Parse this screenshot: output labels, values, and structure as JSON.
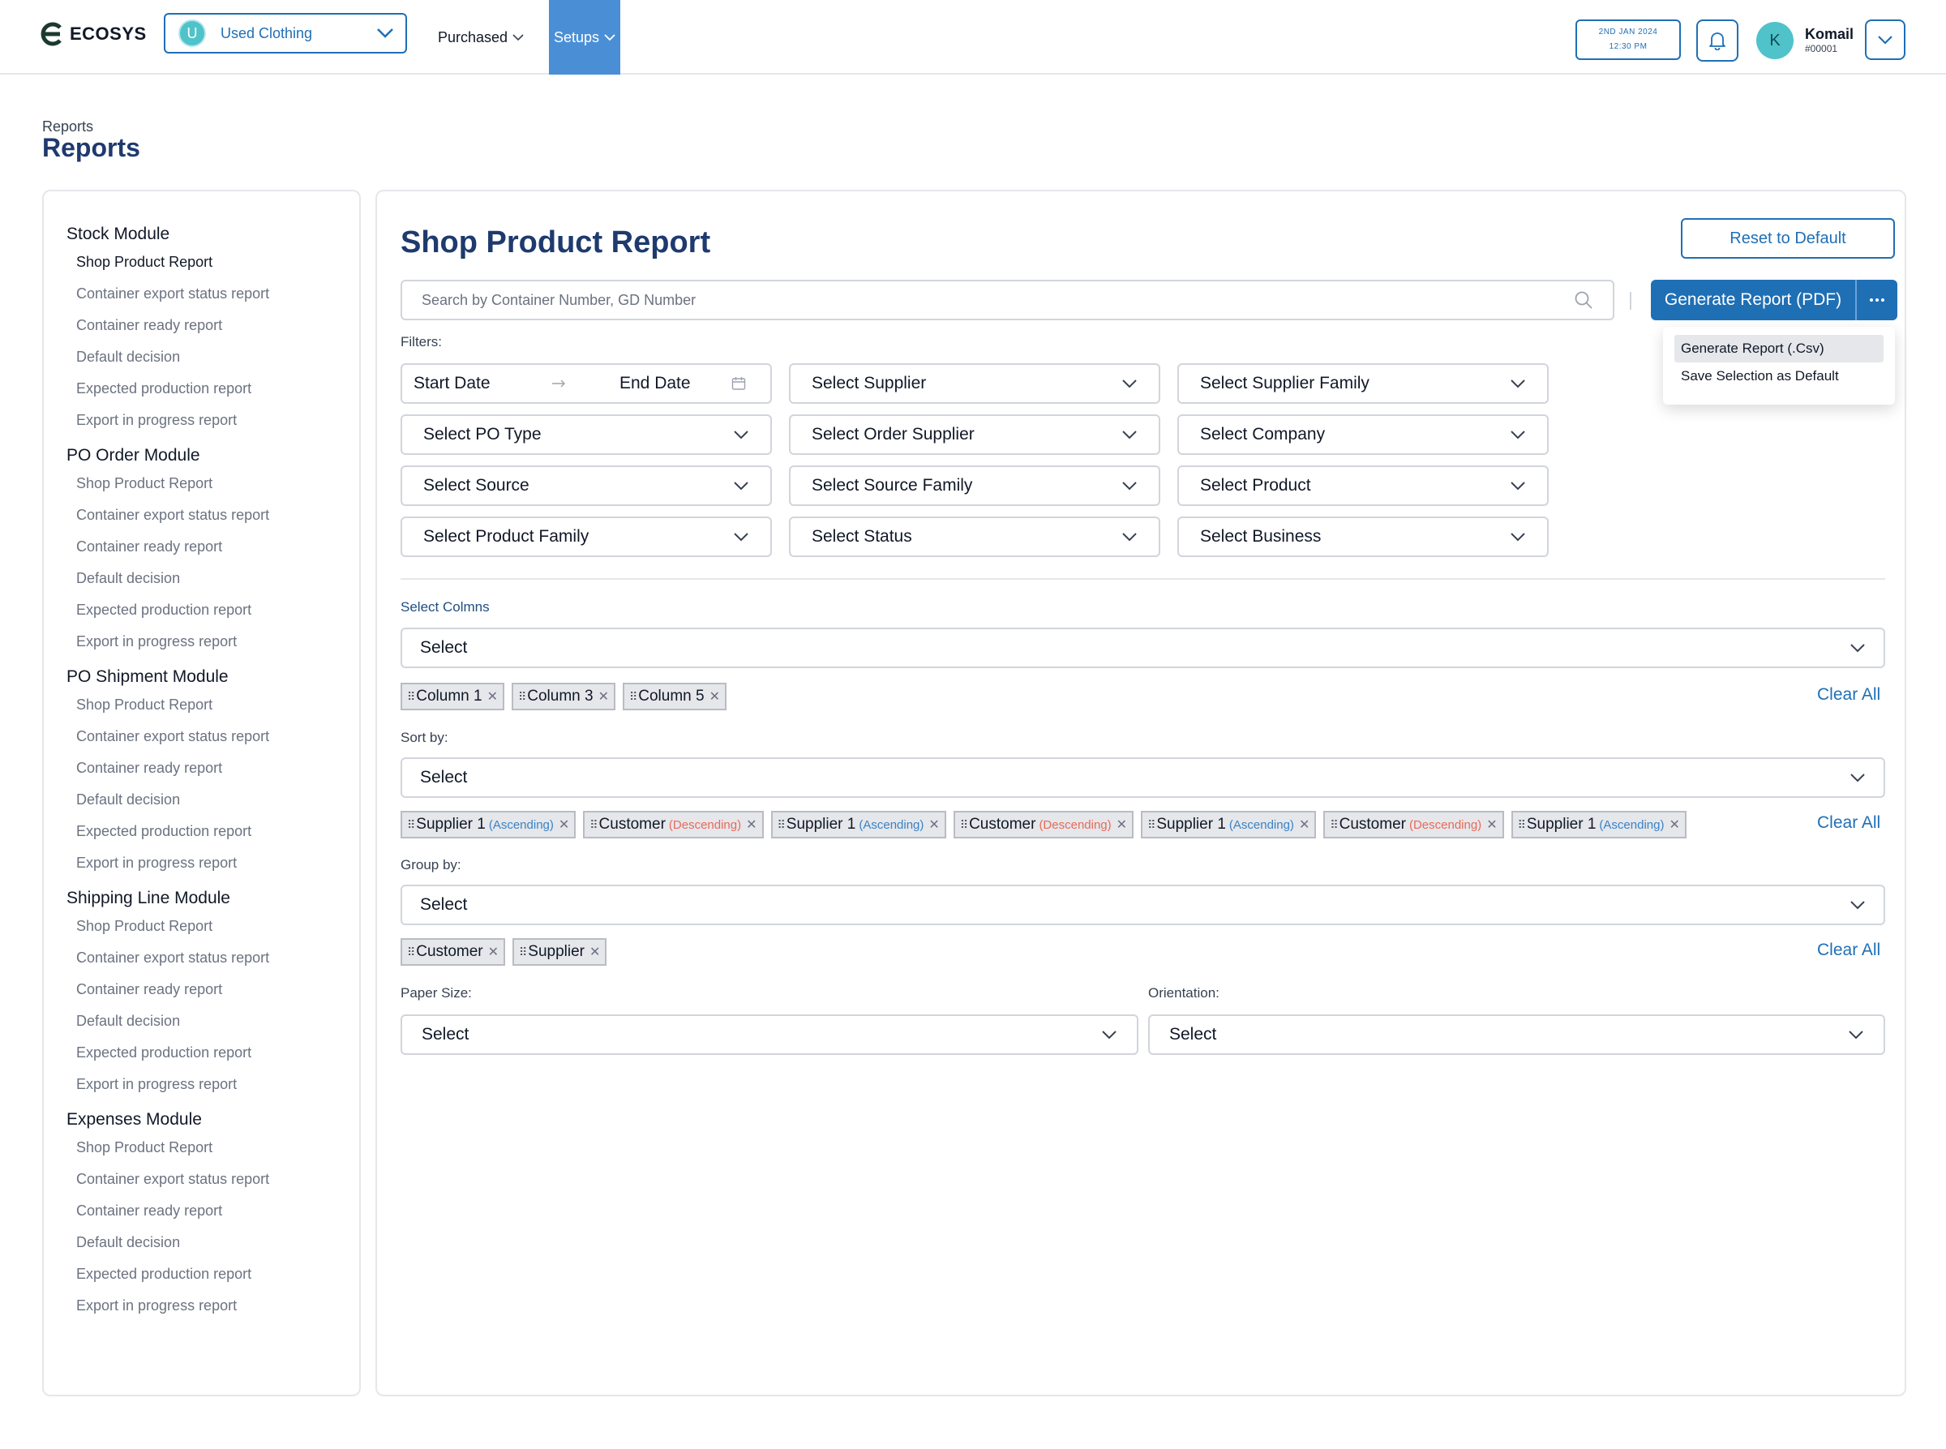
{
  "app": {
    "name": "ECOSYS"
  },
  "business": {
    "initial": "U",
    "name": "Used Clothing"
  },
  "nav": {
    "purchased": "Purchased",
    "setups": "Setups"
  },
  "datetime": {
    "date": "2ND JAN 2024",
    "time": "12:30 PM"
  },
  "user": {
    "initial": "K",
    "name": "Komail",
    "id": "#00001"
  },
  "breadcrumb": "Reports",
  "page_title": "Reports",
  "sidebar": {
    "modules": [
      {
        "title": "Stock Module",
        "items": [
          "Shop Product Report",
          "Container export status report",
          "Container ready report",
          "Default decision",
          "Expected production report",
          "Export in progress report"
        ]
      },
      {
        "title": "PO Order Module",
        "items": [
          "Shop Product Report",
          "Container export status report",
          "Container ready report",
          "Default decision",
          "Expected production report",
          "Export in progress report"
        ]
      },
      {
        "title": "PO Shipment Module",
        "items": [
          "Shop Product Report",
          "Container export status report",
          "Container ready report",
          "Default decision",
          "Expected production report",
          "Export in progress report"
        ]
      },
      {
        "title": "Shipping Line Module",
        "items": [
          "Shop Product Report",
          "Container export status report",
          "Container ready report",
          "Default decision",
          "Expected production report",
          "Export in progress report"
        ]
      },
      {
        "title": "Expenses Module",
        "items": [
          "Shop Product Report",
          "Container export status report",
          "Container ready report",
          "Default decision",
          "Expected production report",
          "Export in progress report"
        ]
      }
    ]
  },
  "report": {
    "title": "Shop Product Report",
    "reset_label": "Reset to Default",
    "search_placeholder": "Search by Container Number, GD Number",
    "generate_label": "Generate Report (PDF)",
    "generate_menu": [
      "Generate Report (.Csv)",
      "Save Selection as Default"
    ],
    "filters_label": "Filters:",
    "start_date": "Start Date",
    "end_date": "End Date",
    "filters": [
      "Select Supplier",
      "Select Supplier Family",
      "Select PO Type",
      "Select Order Supplier",
      "Select Company",
      "Select Source",
      "Select Source Family",
      "Select Product",
      "Select Product Family",
      "Select Status",
      "Select Business"
    ],
    "columns_label": "Select Colmns",
    "columns_select": "Select",
    "column_chips": [
      "Column 1",
      "Column 3",
      "Column 5"
    ],
    "sort_label": "Sort by:",
    "sort_select": "Select",
    "sort_chips": [
      {
        "name": "Supplier 1",
        "order": "(Ascending)"
      },
      {
        "name": "Customer",
        "order": "(Descending)"
      },
      {
        "name": "Supplier 1",
        "order": "(Ascending)"
      },
      {
        "name": "Customer",
        "order": "(Descending)"
      },
      {
        "name": "Supplier 1",
        "order": "(Ascending)"
      },
      {
        "name": "Customer",
        "order": "(Descending)"
      },
      {
        "name": "Supplier 1",
        "order": "(Ascending)"
      }
    ],
    "group_label": "Group by:",
    "group_select": "Select",
    "group_chips": [
      "Customer",
      "Supplier"
    ],
    "clear_all": "Clear All",
    "paper_label": "Paper Size:",
    "paper_select": "Select",
    "orientation_label": "Orientation:",
    "orientation_select": "Select"
  },
  "colors": {
    "primary": "#1f6fb5",
    "heading": "#1e3a6e",
    "accent_teal": "#4fc3c9",
    "nav_active": "#4a8fd6",
    "ascending": "#3b82c4",
    "descending": "#e86a5a"
  },
  "icons": [
    "ecosys-logo-icon",
    "chevron-down-icon",
    "bell-icon",
    "search-icon",
    "arrow-right-icon",
    "calendar-icon",
    "more-dots-icon",
    "grip-icon",
    "close-icon"
  ]
}
